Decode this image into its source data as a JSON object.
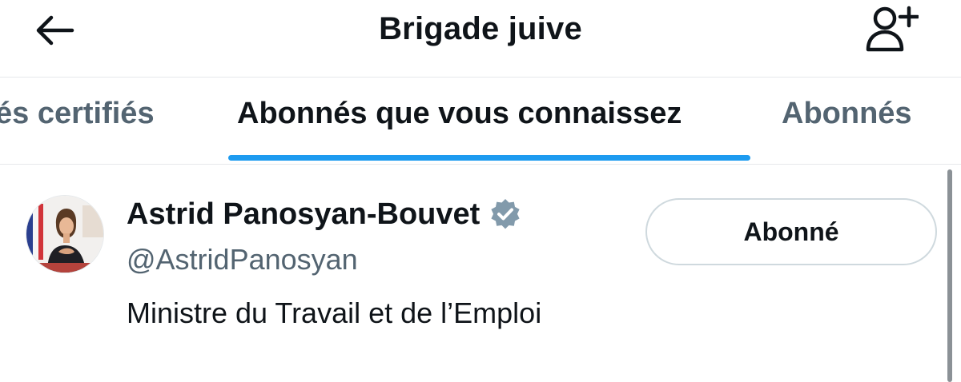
{
  "header": {
    "title": "Brigade juive",
    "back_icon": "arrow-left-icon",
    "follow_icon": "person-add-icon"
  },
  "tabs": [
    {
      "label": "és certifiés",
      "active": false
    },
    {
      "label": "Abonnés que vous connaissez",
      "active": true
    },
    {
      "label": "Abonnés",
      "active": false
    }
  ],
  "user": {
    "name": "Astrid Panosyan-Bouvet",
    "verified_icon": "verified-badge-icon",
    "handle": "@AstridPanosyan",
    "bio": "Ministre du Travail et de l’Emploi",
    "follow_button_label": "Abonné"
  },
  "colors": {
    "accent": "#1d9bf0",
    "text_primary": "#0f1419",
    "text_secondary": "#536471",
    "border": "#cfd9de",
    "verified_badge": "#829aab"
  }
}
